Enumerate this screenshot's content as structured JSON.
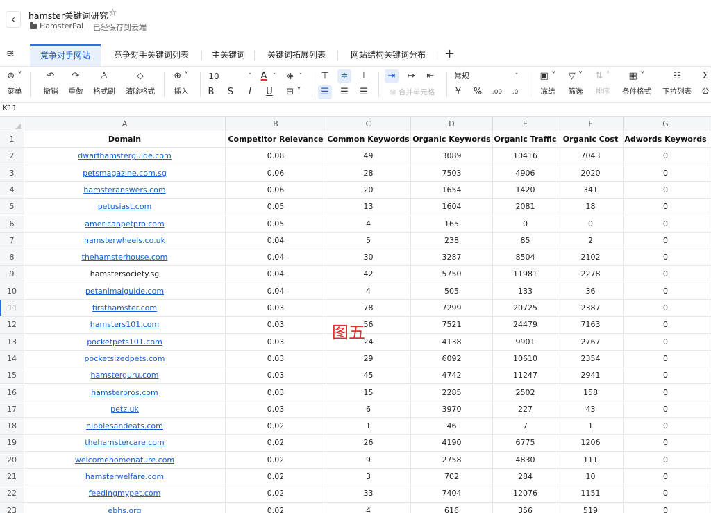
{
  "header": {
    "back_icon": "back-chevron-icon",
    "title": "hamster关键词研究",
    "star_icon": "star-outline-icon",
    "owner": "HamsterPal",
    "save_status": "已经保存到云端"
  },
  "tabs": {
    "active_index": 0,
    "items": [
      {
        "label": "竞争对手网站"
      },
      {
        "label": "竞争对手关键词列表"
      },
      {
        "label": "主关键词"
      },
      {
        "label": "关键词拓展列表"
      },
      {
        "label": "网站结构关键词分布"
      }
    ],
    "add_label": "+"
  },
  "toolbar": {
    "menu": "菜单",
    "undo": "撤销",
    "redo": "重做",
    "format_painter": "格式刷",
    "clear_format": "清除格式",
    "insert": "插入",
    "font_size": "10",
    "number_format": "常规",
    "merge_cells": "合并单元格",
    "currency": "¥",
    "percent": "%",
    "dec_inc": ".00",
    "dec_dec": ".0",
    "freeze": "冻结",
    "filter": "筛选",
    "sort": "排序",
    "conditional_format": "条件格式",
    "dropdown_list": "下拉列表",
    "formula_partial": "公",
    "sigma": "Σ",
    "bold": "B",
    "strike": "S",
    "italic": "I",
    "underline": "U",
    "font_color": "A",
    "accent_color": "#2e6de6",
    "font_color_value": "#e0312e"
  },
  "formula_bar": {
    "cell_ref": "K11"
  },
  "grid": {
    "column_letters": [
      "A",
      "B",
      "C",
      "D",
      "E",
      "F",
      "G"
    ],
    "headers": [
      "Domain",
      "Competitor Relevance",
      "Common Keywords",
      "Organic Keywords",
      "Organic Traffic",
      "Organic Cost",
      "Adwords Keywords"
    ],
    "selected_row": 11,
    "rows": [
      {
        "n": "2",
        "cells": [
          "dwarfhamsterguide.com",
          "0.08",
          "49",
          "3089",
          "10416",
          "7043",
          "0"
        ],
        "link": true
      },
      {
        "n": "3",
        "cells": [
          "petsmagazine.com.sg",
          "0.06",
          "28",
          "7503",
          "4906",
          "2020",
          "0"
        ],
        "link": true
      },
      {
        "n": "4",
        "cells": [
          "hamsteranswers.com",
          "0.06",
          "20",
          "1654",
          "1420",
          "341",
          "0"
        ],
        "link": true
      },
      {
        "n": "5",
        "cells": [
          "petusiast.com",
          "0.05",
          "13",
          "1604",
          "2081",
          "18",
          "0"
        ],
        "link": true
      },
      {
        "n": "6",
        "cells": [
          "americanpetpro.com",
          "0.05",
          "4",
          "165",
          "0",
          "0",
          "0"
        ],
        "link": true
      },
      {
        "n": "7",
        "cells": [
          "hamsterwheels.co.uk",
          "0.04",
          "5",
          "238",
          "85",
          "2",
          "0"
        ],
        "link": true
      },
      {
        "n": "8",
        "cells": [
          "thehamsterhouse.com",
          "0.04",
          "30",
          "3287",
          "8504",
          "2102",
          "0"
        ],
        "link": true
      },
      {
        "n": "9",
        "cells": [
          "hamstersociety.sg",
          "0.04",
          "42",
          "5750",
          "11981",
          "2278",
          "0"
        ],
        "link": false
      },
      {
        "n": "10",
        "cells": [
          "petanimalguide.com",
          "0.04",
          "4",
          "505",
          "133",
          "36",
          "0"
        ],
        "link": true
      },
      {
        "n": "11",
        "cells": [
          "firsthamster.com",
          "0.03",
          "78",
          "7299",
          "20725",
          "2387",
          "0"
        ],
        "link": true
      },
      {
        "n": "12",
        "cells": [
          "hamsters101.com",
          "0.03",
          "56",
          "7521",
          "24479",
          "7163",
          "0"
        ],
        "link": true
      },
      {
        "n": "13",
        "cells": [
          "pocketpets101.com",
          "0.03",
          "24",
          "4138",
          "9901",
          "2767",
          "0"
        ],
        "link": true
      },
      {
        "n": "14",
        "cells": [
          "pocketsizedpets.com",
          "0.03",
          "29",
          "6092",
          "10610",
          "2354",
          "0"
        ],
        "link": true
      },
      {
        "n": "15",
        "cells": [
          "hamsterguru.com",
          "0.03",
          "45",
          "4742",
          "11247",
          "2941",
          "0"
        ],
        "link": true
      },
      {
        "n": "16",
        "cells": [
          "hamsterpros.com",
          "0.03",
          "15",
          "2285",
          "2502",
          "158",
          "0"
        ],
        "link": true
      },
      {
        "n": "17",
        "cells": [
          "petz.uk",
          "0.03",
          "6",
          "3970",
          "227",
          "43",
          "0"
        ],
        "link": true
      },
      {
        "n": "18",
        "cells": [
          "nibblesandeats.com",
          "0.02",
          "1",
          "46",
          "7",
          "1",
          "0"
        ],
        "link": true
      },
      {
        "n": "19",
        "cells": [
          "thehamstercare.com",
          "0.02",
          "26",
          "4190",
          "6775",
          "1206",
          "0"
        ],
        "link": true
      },
      {
        "n": "20",
        "cells": [
          "welcomehomenature.com",
          "0.02",
          "9",
          "2758",
          "4830",
          "111",
          "0"
        ],
        "link": true
      },
      {
        "n": "21",
        "cells": [
          "hamsterwelfare.com",
          "0.02",
          "3",
          "702",
          "284",
          "10",
          "0"
        ],
        "link": true
      },
      {
        "n": "22",
        "cells": [
          "feedingmypet.com",
          "0.02",
          "33",
          "7404",
          "12076",
          "1151",
          "0"
        ],
        "link": true
      },
      {
        "n": "23",
        "cells": [
          "ebhs.org",
          "0.02",
          "4",
          "616",
          "356",
          "519",
          "0"
        ],
        "link": true
      }
    ]
  },
  "overlay": {
    "watermark": "图五"
  }
}
